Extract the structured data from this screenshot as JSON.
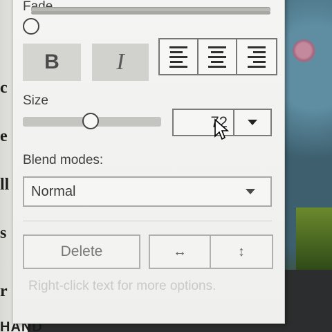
{
  "panel": {
    "fade": {
      "label": "Fade",
      "level": 0.0
    },
    "style_buttons": {
      "bold_label": "B",
      "italic_label": "I"
    },
    "alignment_buttons": [
      "align-left-icon",
      "align-center-icon",
      "align-right-icon"
    ],
    "size": {
      "label": "Size",
      "value": "72",
      "slider_level": 0.52
    },
    "blend": {
      "label": "Blend modes:",
      "selected": "Normal"
    },
    "actions": {
      "delete_label": "Delete",
      "flip_horizontal_icon": "↔",
      "flip_vertical_icon": "↕"
    },
    "hint": "Right-click text for more options."
  },
  "background": {
    "left_fragments": [
      "c",
      "e",
      "ll",
      "s",
      "r"
    ],
    "bottom_text": "HAND"
  },
  "colors": {
    "panel_bg": "#f0f0ee",
    "button_active": "#d3d3d0",
    "text": "#3f3f3f",
    "hint_text": "#c9c9c6"
  }
}
